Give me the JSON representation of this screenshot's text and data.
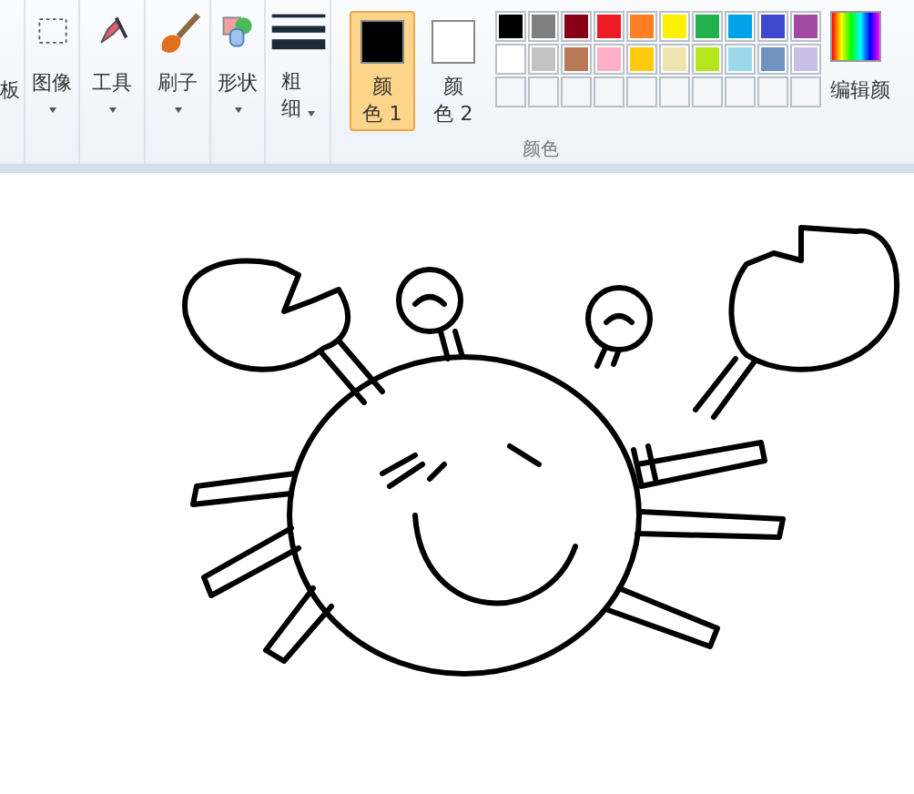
{
  "ribbon": {
    "tools": [
      {
        "kind": "clipboard",
        "label": "板",
        "dropdown": false
      },
      {
        "kind": "image",
        "label": "图像",
        "dropdown": true
      },
      {
        "kind": "tools",
        "label": "工具",
        "dropdown": true
      },
      {
        "kind": "brushes",
        "label": "刷子",
        "dropdown": true
      },
      {
        "kind": "shapes",
        "label": "形状",
        "dropdown": true
      },
      {
        "kind": "size",
        "label": "粗细",
        "dropdown": true
      }
    ],
    "active_colors": [
      {
        "label": "颜色 1",
        "color": "#000000",
        "selected": true
      },
      {
        "label": "颜色 2",
        "color": "#ffffff",
        "selected": false
      }
    ],
    "palette": [
      [
        {
          "kind": "color",
          "color": "#000000"
        },
        {
          "kind": "color",
          "color": "#7f7f7f"
        },
        {
          "kind": "color",
          "color": "#880015"
        },
        {
          "kind": "color",
          "color": "#ed1c24"
        },
        {
          "kind": "color",
          "color": "#ff7f27"
        },
        {
          "kind": "color",
          "color": "#fff200"
        },
        {
          "kind": "color",
          "color": "#22b14c"
        },
        {
          "kind": "color",
          "color": "#00a2e8"
        },
        {
          "kind": "color",
          "color": "#3f48cc"
        },
        {
          "kind": "color",
          "color": "#a349a4"
        }
      ],
      [
        {
          "kind": "color",
          "color": "#ffffff"
        },
        {
          "kind": "color",
          "color": "#c3c3c3"
        },
        {
          "kind": "color",
          "color": "#b97a57"
        },
        {
          "kind": "color",
          "color": "#ffaec9"
        },
        {
          "kind": "color",
          "color": "#ffc90e"
        },
        {
          "kind": "color",
          "color": "#efe4b0"
        },
        {
          "kind": "color",
          "color": "#b5e61d"
        },
        {
          "kind": "color",
          "color": "#99d9ea"
        },
        {
          "kind": "color",
          "color": "#7092be"
        },
        {
          "kind": "color",
          "color": "#c8bfe7"
        }
      ],
      [
        {
          "kind": "empty"
        },
        {
          "kind": "empty"
        },
        {
          "kind": "empty"
        },
        {
          "kind": "empty"
        },
        {
          "kind": "empty"
        },
        {
          "kind": "empty"
        },
        {
          "kind": "empty"
        },
        {
          "kind": "empty"
        },
        {
          "kind": "empty"
        },
        {
          "kind": "empty"
        }
      ]
    ],
    "group_label": "颜色",
    "edit_colors": "编辑颜"
  }
}
